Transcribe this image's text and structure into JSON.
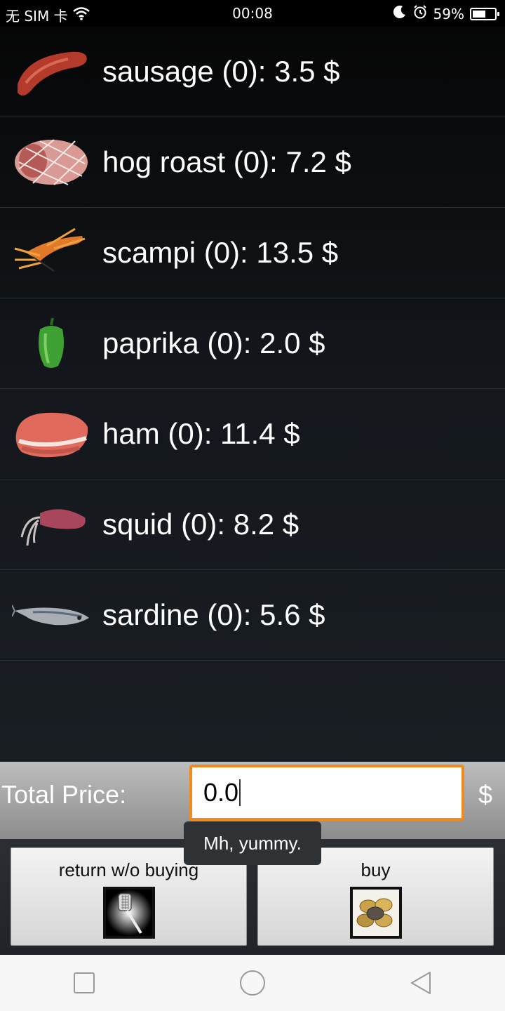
{
  "status_bar": {
    "carrier": "无 SIM 卡",
    "time": "00:08",
    "battery": "59%",
    "battery_level": 0.59
  },
  "items": [
    {
      "label": "sausage (0): 3.5 $",
      "icon": "sausage-icon"
    },
    {
      "label": "hog roast (0): 7.2 $",
      "icon": "hog-roast-icon"
    },
    {
      "label": "scampi (0): 13.5 $",
      "icon": "scampi-icon"
    },
    {
      "label": "paprika (0): 2.0 $",
      "icon": "paprika-icon"
    },
    {
      "label": "ham (0): 11.4 $",
      "icon": "ham-icon"
    },
    {
      "label": "squid (0): 8.2 $",
      "icon": "squid-icon"
    },
    {
      "label": "sardine (0): 5.6 $",
      "icon": "sardine-icon"
    }
  ],
  "total": {
    "label": "Total Price:",
    "value": "0.0",
    "currency": "$"
  },
  "buttons": {
    "return_label": "return w/o buying",
    "buy_label": "buy"
  },
  "toast": "Mh, yummy.",
  "colors": {
    "accent": "#f08a1c",
    "background": "#1d2228"
  }
}
